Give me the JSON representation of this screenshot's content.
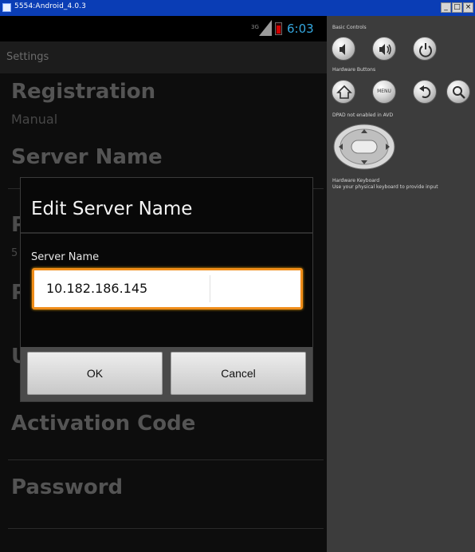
{
  "window": {
    "title": "5554:Android_4.0.3",
    "controls": [
      "minimize",
      "maximize",
      "close"
    ]
  },
  "status_bar": {
    "network": "3G",
    "time": "6:03"
  },
  "app": {
    "title": "Settings"
  },
  "preferences": [
    {
      "title": "Registration",
      "summary": "Manual"
    },
    {
      "title": "Server Name",
      "summary": ""
    },
    {
      "title": "Activation Code",
      "summary": ""
    },
    {
      "title": "Password",
      "summary": ""
    },
    {
      "title": "Port",
      "summary": "5"
    }
  ],
  "dialog": {
    "title": "Edit Server Name",
    "field_label": "Server Name",
    "field_value": "10.182.186.145",
    "ok_label": "OK",
    "cancel_label": "Cancel"
  },
  "skin": {
    "basic_controls": "Basic Controls",
    "hardware_buttons": "Hardware Buttons",
    "dpad_note": "DPAD not enabled in AVD",
    "keyboard_title": "Hardware Keyboard",
    "keyboard_hint": "Use your physical keyboard to provide input",
    "menu_label": "MENU"
  },
  "colors": {
    "accent_blue": "#35a8e0",
    "focus_orange": "#f08d1a",
    "window_titlebar": "#0a3db5"
  },
  "icons": [
    "volume-down-icon",
    "volume-up-icon",
    "power-icon",
    "home-icon",
    "menu-icon",
    "back-icon",
    "search-icon",
    "dpad-icon",
    "signal-icon",
    "battery-icon"
  ]
}
